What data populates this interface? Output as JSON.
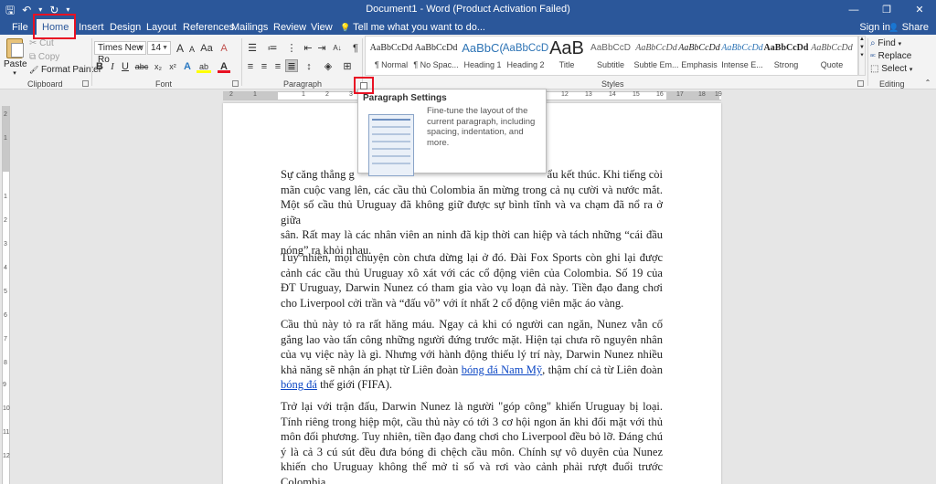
{
  "window": {
    "title": "Document1 - Word (Product Activation Failed)",
    "minimize_icon": "—",
    "restore_icon": "❐",
    "close_icon": "✕"
  },
  "qat": {
    "save_icon": "🖫",
    "undo_icon": "↶",
    "undo_dd": "▾",
    "redo_icon": "↻",
    "customize_icon": "▾"
  },
  "tabs": {
    "file": "File",
    "home": "Home",
    "insert": "Insert",
    "design": "Design",
    "layout": "Layout",
    "references": "References",
    "mailings": "Mailings",
    "review": "Review",
    "view": "View",
    "tellme_icon": "💡",
    "tellme": "Tell me what you want to do...",
    "signin": "Sign in",
    "share_icon": "👤",
    "share": "Share"
  },
  "clipboard": {
    "paste": "Paste",
    "paste_dd": "▾",
    "cut": "Cut",
    "cut_icon": "✂",
    "copy": "Copy",
    "copy_icon": "⧉",
    "format_painter": "Format Painter",
    "format_painter_icon": "🖌",
    "label": "Clipboard"
  },
  "font": {
    "name": "Times New Ro",
    "size": "14",
    "grow": "A",
    "shrink": "A",
    "case": "Aa",
    "clear": "A",
    "bold": "B",
    "italic": "I",
    "underline": "U",
    "strike": "abc",
    "subscript": "x₂",
    "superscript": "x²",
    "effects": "A",
    "highlight": "ab",
    "color": "A",
    "label": "Font"
  },
  "paragraph": {
    "bullets": "☰",
    "numbering": "≔",
    "multilevel": "⋮",
    "decrease_indent": "⇤",
    "increase_indent": "⇥",
    "sort": "A↓",
    "show_marks": "¶",
    "align_left": "≡",
    "center": "≡",
    "align_right": "≡",
    "justify": "≣",
    "line_spacing": "↕",
    "shading": "◈",
    "borders": "⊞",
    "label": "Paragraph",
    "launcher": "↘"
  },
  "styles": {
    "label": "Styles",
    "items": [
      {
        "preview": "AaBbCcDd",
        "name": "¶ Normal"
      },
      {
        "preview": "AaBbCcDd",
        "name": "¶ No Spac..."
      },
      {
        "preview": "AaBbC(",
        "name": "Heading 1"
      },
      {
        "preview": "AaBbCcD",
        "name": "Heading 2"
      },
      {
        "preview": "AaB",
        "name": "Title"
      },
      {
        "preview": "AaBbCcD",
        "name": "Subtitle"
      },
      {
        "preview": "AaBbCcDd",
        "name": "Subtle Em..."
      },
      {
        "preview": "AaBbCcDd",
        "name": "Emphasis"
      },
      {
        "preview": "AaBbCcDd",
        "name": "Intense E..."
      },
      {
        "preview": "AaBbCcDd",
        "name": "Strong"
      },
      {
        "preview": "AaBbCcDd",
        "name": "Quote"
      }
    ],
    "scroll_up": "▲",
    "scroll_down": "▼",
    "more": "⯆"
  },
  "editing": {
    "label": "Editing",
    "find": "Find",
    "find_icon": "⌕",
    "replace": "Replace",
    "replace_icon": "ᵃᶜ",
    "select": "Select",
    "select_icon": "⬚"
  },
  "ruler": {
    "numbers": [
      "2",
      "1",
      "1",
      "2",
      "3",
      "4",
      "5",
      "6",
      "7",
      "8",
      "9",
      "10",
      "11",
      "12",
      "13",
      "14",
      "15",
      "16",
      "17",
      "18",
      "19"
    ],
    "vnumbers": [
      "2",
      "1",
      "1",
      "2",
      "3",
      "4",
      "5",
      "6",
      "7",
      "8",
      "9",
      "10",
      "11",
      "12"
    ]
  },
  "tooltip": {
    "title": "Paragraph Settings",
    "description": "Fine-tune the layout of the current paragraph, including spacing, indentation, and more."
  },
  "document": {
    "p1_start": "Sự căng thẳng g",
    "p1_end": "ẩu kết thúc. Khi tiếng còi",
    "p1_line2": "mãn cuộc vang lên, các cầu thủ Colombia ăn mừng trong cả nụ cười và nước mắt.",
    "p1_line3": "Một số cầu thủ Uruguay đã không giữ được sự bình tĩnh và va chạm đã nổ ra ở giữa",
    "p1_line4": "sân. Rất may là các nhân viên an ninh đã kịp thời can hiệp và tách những “cái đầu",
    "p1_line5": "nóng” ra khỏi nhau.",
    "p2": "Tuy nhiên, mọi chuyện còn chưa dừng lại ở đó. Đài Fox Sports còn ghi lại được cảnh các cầu thủ Uruguay xô xát với các cổ động viên của Colombia. Số 19 của ĐT Uruguay, Darwin Nunez có tham gia vào vụ loạn đả này. Tiền đạo đang chơi cho Liverpool cởi trần và “đấu võ” với ít nhất 2 cổ động viên mặc áo vàng.",
    "p3_a": "Cầu thủ này tỏ ra rất hăng máu. Ngay cả khi có người can ngăn, Nunez vẫn cố gắng lao vào tấn công những người đứng trước mặt. Hiện tại chưa rõ nguyên nhân của vụ việc này là gì. Nhưng với hành động thiếu lý trí này, Darwin Nunez nhiều khả năng sẽ nhận án phạt từ Liên đoàn ",
    "p3_link1": "bóng đá Nam Mỹ",
    "p3_b": ", thậm chí cả từ Liên đoàn ",
    "p3_link2": "bóng đá",
    "p3_c": " thế giới (FIFA).",
    "p4": "Trở lại với trận đấu, Darwin Nunez là người \"góp công\" khiến Uruguay bị loại. Tính riêng trong hiệp một, cầu thủ này có tới 3 cơ hội ngon ăn khi đối mặt với thủ môn đối phương. Tuy nhiên, tiền đạo đang chơi cho Liverpool đều bỏ lỡ. Đáng chú ý là cả 3 cú sút đều đưa bóng đi chệch cầu môn. Chính sự vô duyên của Nunez khiến cho Uruguay không thể mở tỉ số và rơi vào cảnh phải rượt đuổi trước Colombia."
  }
}
